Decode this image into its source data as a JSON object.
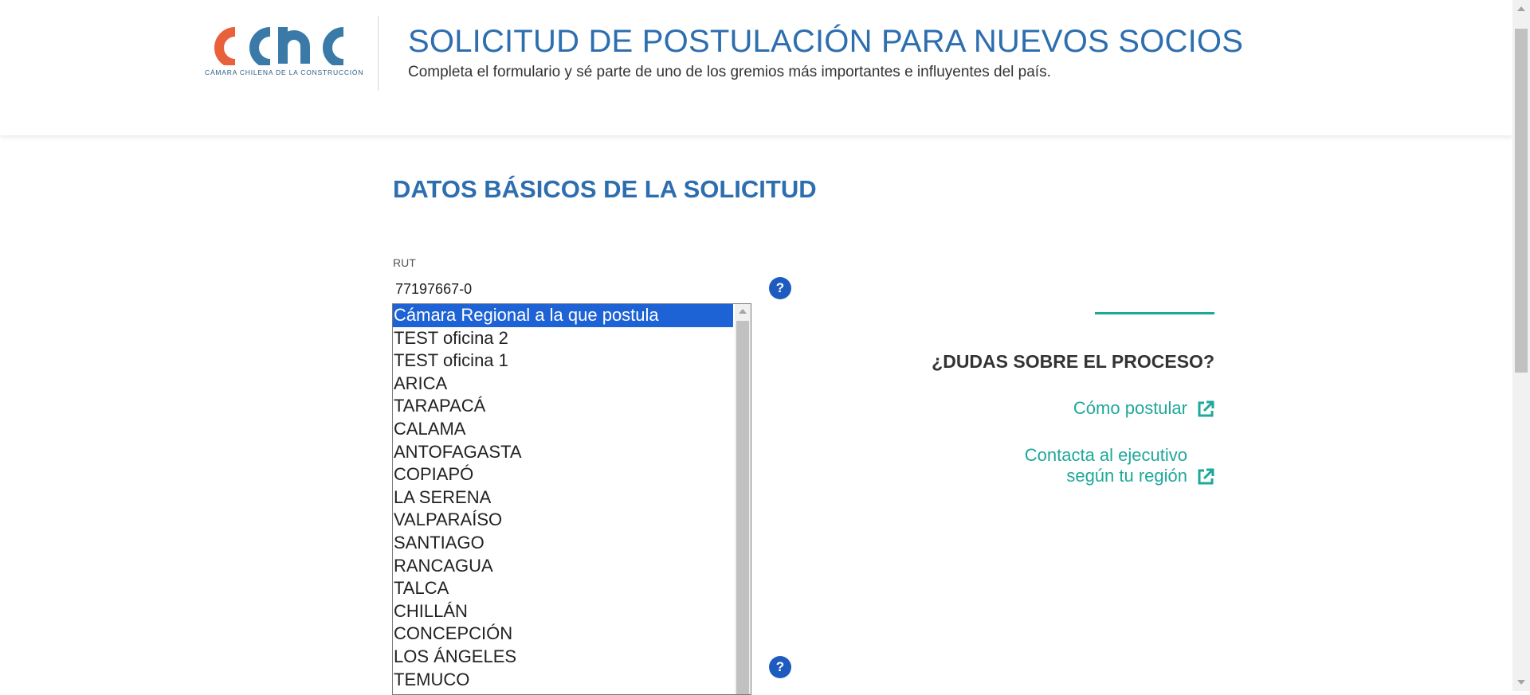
{
  "header": {
    "logo_text": "cchc",
    "logo_subtitle": "CÁMARA CHILENA DE LA CONSTRUCCIÓN",
    "title": "SOLICITUD DE POSTULACIÓN PARA NUEVOS SOCIOS",
    "subtitle": "Completa el formulario y sé parte de uno de los gremios más importantes e influyentes del país."
  },
  "main": {
    "section_title": "DATOS BÁSICOS DE LA SOLICITUD",
    "rut": {
      "label": "RUT",
      "value": "77197667-0",
      "help_icon": "?"
    },
    "camara_select": {
      "options": [
        "Cámara Regional a la que postula",
        "TEST oficina 2",
        "TEST oficina 1",
        "ARICA",
        "TARAPACÁ",
        "CALAMA",
        "ANTOFAGASTA",
        "COPIAPÓ",
        "LA SERENA",
        "VALPARAÍSO",
        "SANTIAGO",
        "RANCAGUA",
        "TALCA",
        "CHILLÁN",
        "CONCEPCIÓN",
        "LOS ÁNGELES",
        "TEMUCO"
      ],
      "selected_index": 0
    },
    "second_help_icon": "?"
  },
  "aside": {
    "title": "¿DUDAS SOBRE EL PROCESO?",
    "links": [
      {
        "label": "Cómo postular",
        "icon": "external-link-icon"
      },
      {
        "label_line1": "Contacta al ejecutivo",
        "label_line2": "según tu región",
        "icon": "external-link-icon"
      }
    ]
  },
  "colors": {
    "brand_blue": "#2d6eaf",
    "logo_orange": "#e8613a",
    "logo_blue": "#3a7aa8",
    "accent_teal": "#1ea89a",
    "help_blue": "#1e5bbf",
    "select_highlight": "#1e63d6"
  }
}
